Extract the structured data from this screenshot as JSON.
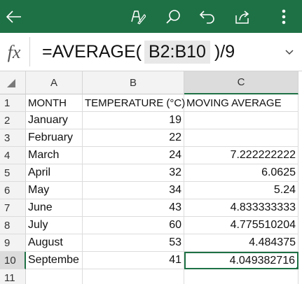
{
  "toolbar": {
    "back_icon": "arrow-left-icon",
    "icons": [
      "pen-icon",
      "search-icon",
      "undo-icon",
      "share-icon",
      "more-vertical-icon"
    ],
    "color": "#1e7145"
  },
  "formula_bar": {
    "fx_label": "fx",
    "formula_prefix": "=AVERAGE(",
    "formula_ref": "B2:B10",
    "formula_suffix": ")/9"
  },
  "sheet": {
    "columns": [
      "A",
      "B",
      "C"
    ],
    "selected_column": "C",
    "rows": [
      {
        "num": "1",
        "a": "MONTH",
        "b": "TEMPERATURE (°C)",
        "c": "MOVING AVERAGE"
      },
      {
        "num": "2",
        "a": "January",
        "b": "19",
        "c": ""
      },
      {
        "num": "3",
        "a": "February",
        "b": "22",
        "c": ""
      },
      {
        "num": "4",
        "a": "March",
        "b": "24",
        "c": "7.222222222"
      },
      {
        "num": "5",
        "a": "April",
        "b": "32",
        "c": "6.0625"
      },
      {
        "num": "6",
        "a": "May",
        "b": "34",
        "c": "5.24"
      },
      {
        "num": "7",
        "a": "June",
        "b": "43",
        "c": "4.833333333"
      },
      {
        "num": "8",
        "a": "July",
        "b": "60",
        "c": "4.775510204"
      },
      {
        "num": "9",
        "a": "August",
        "b": "53",
        "c": "4.484375"
      },
      {
        "num": "10",
        "a": "Septembe",
        "b": "41",
        "c": "4.049382716"
      },
      {
        "num": "11",
        "a": "",
        "b": "",
        "c": ""
      }
    ],
    "active_row": "10",
    "active_column": "C"
  }
}
